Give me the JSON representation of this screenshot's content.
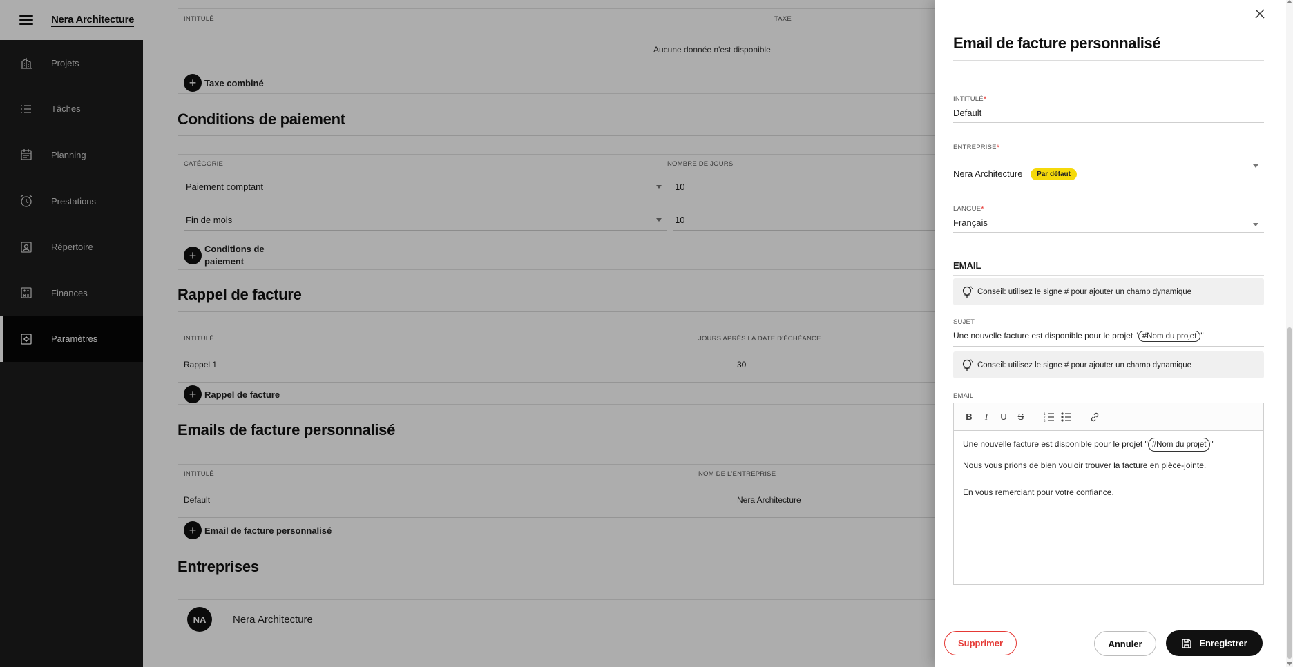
{
  "app": {
    "brand": "Nera Architecture"
  },
  "sidebar": {
    "items": [
      {
        "label": "Projets",
        "icon": "building-icon"
      },
      {
        "label": "Tâches",
        "icon": "list-icon"
      },
      {
        "label": "Planning",
        "icon": "calendar-icon"
      },
      {
        "label": "Prestations",
        "icon": "clock-icon"
      },
      {
        "label": "Répertoire",
        "icon": "contact-icon"
      },
      {
        "label": "Finances",
        "icon": "finance-icon"
      },
      {
        "label": "Paramètres",
        "icon": "settings-icon",
        "active": true
      }
    ]
  },
  "taxes": {
    "col_title": "INTITULÉ",
    "col_tax": "TAXE",
    "empty": "Aucune donnée n'est disponible",
    "add_label": "Taxe combiné"
  },
  "payment": {
    "title": "Conditions de paiement",
    "col_category": "CATÉGORIE",
    "col_days": "NOMBRE DE JOURS",
    "rows": [
      {
        "category": "Paiement comptant",
        "days": "10"
      },
      {
        "category": "Fin de mois",
        "days": "10"
      }
    ],
    "add_label_1": "Conditions de",
    "add_label_2": "paiement"
  },
  "reminder": {
    "title": "Rappel de facture",
    "col_title": "INTITULÉ",
    "col_days": "JOURS APRÈS LA DATE D'ÉCHÉANCE",
    "rows": [
      {
        "title": "Rappel 1",
        "days": "30"
      }
    ],
    "add_label": "Rappel de facture"
  },
  "emails": {
    "title": "Emails de facture personnalisé",
    "col_title": "INTITULÉ",
    "col_company": "NOM DE L'ENTREPRISE",
    "rows": [
      {
        "title": "Default",
        "company": "Nera Architecture"
      }
    ],
    "add_label": "Email de facture personnalisé"
  },
  "companies": {
    "title": "Entreprises",
    "rows": [
      {
        "initials": "NA",
        "name": "Nera Architecture"
      }
    ]
  },
  "drawer": {
    "title": "Email de facture personnalisé",
    "intitule_label": "INTITULÉ",
    "intitule_value": "Default",
    "entreprise_label": "ENTREPRISE",
    "entreprise_value": "Nera Architecture",
    "entreprise_badge": "Par défaut",
    "langue_label": "LANGUE",
    "langue_value": "Français",
    "email_section": "EMAIL",
    "tip": "Conseil: utilisez le signe # pour ajouter un champ dynamique",
    "sujet_label": "SUJET",
    "sujet_prefix": "Une nouvelle facture est disponible pour le projet \"",
    "sujet_chip": "#Nom du projet",
    "sujet_suffix": "\"",
    "email_label": "EMAIL",
    "body_line1_prefix": "Une nouvelle facture est disponible pour le projet \"",
    "body_line1_chip": "#Nom du projet",
    "body_line1_suffix": "\"",
    "body_line2": "Nous vous prions de bien vouloir trouver la facture en pièce-jointe.",
    "body_line3": "En vous remerciant pour votre confiance.",
    "delete_label": "Supprimer",
    "cancel_label": "Annuler",
    "save_label": "Enregistrer"
  },
  "colors": {
    "accent_yellow": "#f5d90a",
    "danger": "#e53935",
    "sidebar_bg": "#1c1c1c"
  }
}
